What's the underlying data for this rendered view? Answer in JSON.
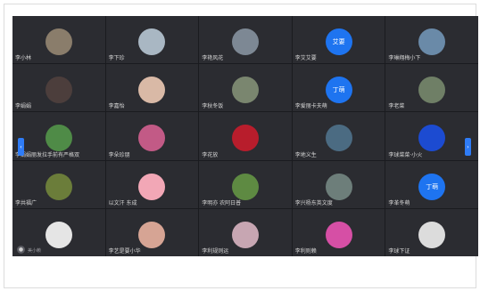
{
  "tiles": [
    {
      "name": "李小林",
      "avatar": "photo",
      "color": "#8a7d6b"
    },
    {
      "name": "李下珍",
      "avatar": "photo",
      "color": "#a9b7c3"
    },
    {
      "name": "李艳风花",
      "avatar": "photo",
      "color": "#7d8894"
    },
    {
      "name": "李艾艾要",
      "avatar": "text",
      "label": "艾要"
    },
    {
      "name": "李琳翔梅小下",
      "avatar": "photo",
      "color": "#6a8aa8"
    },
    {
      "name": "李娟娟",
      "avatar": "photo",
      "color": "#4c3e3c"
    },
    {
      "name": "李嘉怡",
      "avatar": "photo",
      "color": "#d9b9a6"
    },
    {
      "name": "李秋冬饭",
      "avatar": "photo",
      "color": "#7a866f"
    },
    {
      "name": "李爱丽卡夫萌",
      "avatar": "text",
      "label": "丁萌"
    },
    {
      "name": "李老菜",
      "avatar": "photo",
      "color": "#6f7f66"
    },
    {
      "name": "李娟娟丽发拉手前有严格双",
      "avatar": "photo",
      "color": "#4f8b47"
    },
    {
      "name": "李朵珍朋",
      "avatar": "photo",
      "color": "#c25a86"
    },
    {
      "name": "李花放",
      "avatar": "photo",
      "color": "#b81d2c"
    },
    {
      "name": "李地义生",
      "avatar": "photo",
      "color": "#4b6b82"
    },
    {
      "name": "李球菜菜·小火",
      "avatar": "photo",
      "color": "#1c4bd1"
    },
    {
      "name": "李共福广",
      "avatar": "photo",
      "color": "#6b7d3a"
    },
    {
      "name": "以文汗 东成",
      "avatar": "photo",
      "color": "#f2a7b6"
    },
    {
      "name": "李明亦 农阿日普",
      "avatar": "photo",
      "color": "#5e8a42"
    },
    {
      "name": "李兴杨东英文度",
      "avatar": "photo",
      "color": "#6d7e7a"
    },
    {
      "name": "李革冬萌",
      "avatar": "text",
      "label": "丁萌"
    },
    {
      "name": "李球桂家赖脑",
      "avatar": "photo",
      "color": "#e5e5e5"
    },
    {
      "name": "李艺是要小华",
      "avatar": "photo",
      "color": "#d6a494"
    },
    {
      "name": "李利规则运",
      "avatar": "photo",
      "color": "#c7a6b2"
    },
    {
      "name": "李利则赖",
      "avatar": "photo",
      "color": "#d64fa5"
    },
    {
      "name": "李球下证",
      "avatar": "photo",
      "color": "#dcdcdc"
    }
  ],
  "mic_label": "美小赖",
  "nav_left": "‹",
  "nav_right": "›"
}
